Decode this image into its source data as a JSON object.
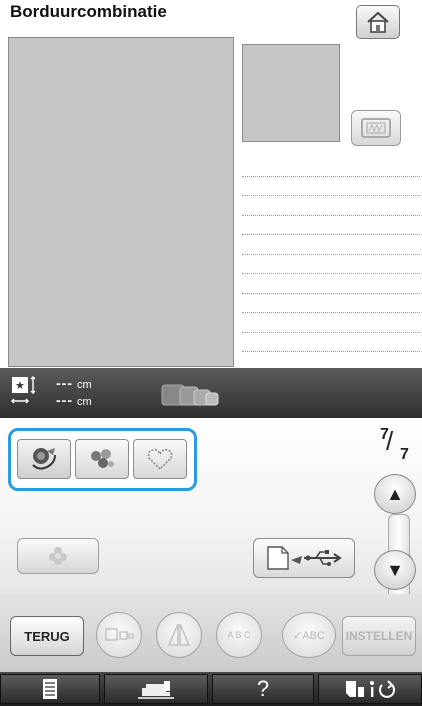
{
  "header": {
    "title": "Borduurcombinatie",
    "home_icon": "home-icon"
  },
  "toolbar": {
    "width_value": "---",
    "height_value": "---",
    "unit": "cm"
  },
  "patterns": {
    "items": [
      {
        "name": "roses-pattern",
        "selected": true
      },
      {
        "name": "flowers-pattern",
        "selected": false
      },
      {
        "name": "heart-pattern",
        "selected": false
      }
    ],
    "highlight_color": "#2a9be2"
  },
  "paging": {
    "current": "7",
    "total": "7"
  },
  "bottom": {
    "back_label": "TERUG",
    "set_label": "INSTELLEN"
  },
  "circle_buttons": {
    "abc_curve": "A B C",
    "abc_check": "✓ABC"
  },
  "taskbar": {
    "help_label": "?"
  }
}
